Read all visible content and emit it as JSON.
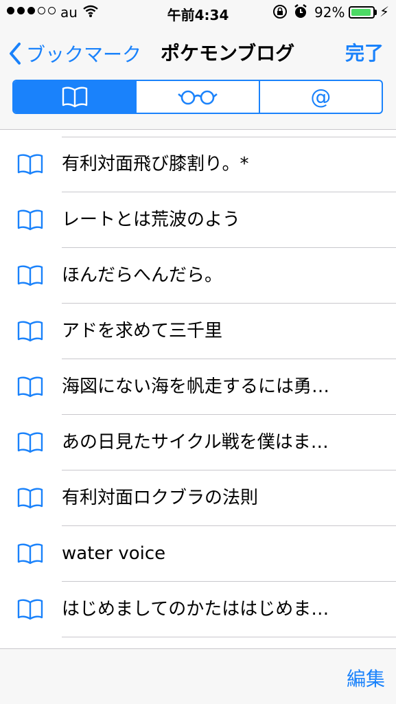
{
  "status": {
    "carrier": "au",
    "time": "午前4:34",
    "battery": "92%",
    "battery_level": 0.92,
    "signal_bars_filled": 3,
    "signal_bars_total": 5
  },
  "nav": {
    "back_label": "ブックマーク",
    "title": "ポケモンブログ",
    "done_label": "完了"
  },
  "segments": [
    {
      "icon": "bookmarks-icon",
      "active": true
    },
    {
      "icon": "reading-list-glasses-icon",
      "active": false
    },
    {
      "label": "@",
      "icon": "shared-links-icon",
      "active": false
    }
  ],
  "bookmarks": [
    {
      "title": "有利対面飛び膝割り。*"
    },
    {
      "title": "レートとは荒波のよう"
    },
    {
      "title": "ほんだらへんだら。"
    },
    {
      "title": "アドを求めて三千里"
    },
    {
      "title": "海図にない海を帆走するには勇…"
    },
    {
      "title": "あの日見たサイクル戦を僕はま…"
    },
    {
      "title": "有利対面ロクブラの法則"
    },
    {
      "title": "water voice"
    },
    {
      "title": "はじめましてのかたははじめま…"
    }
  ],
  "toolbar": {
    "edit_label": "編集"
  },
  "colors": {
    "accent": "#1a82fb",
    "battery_fill": "#4cd964"
  }
}
